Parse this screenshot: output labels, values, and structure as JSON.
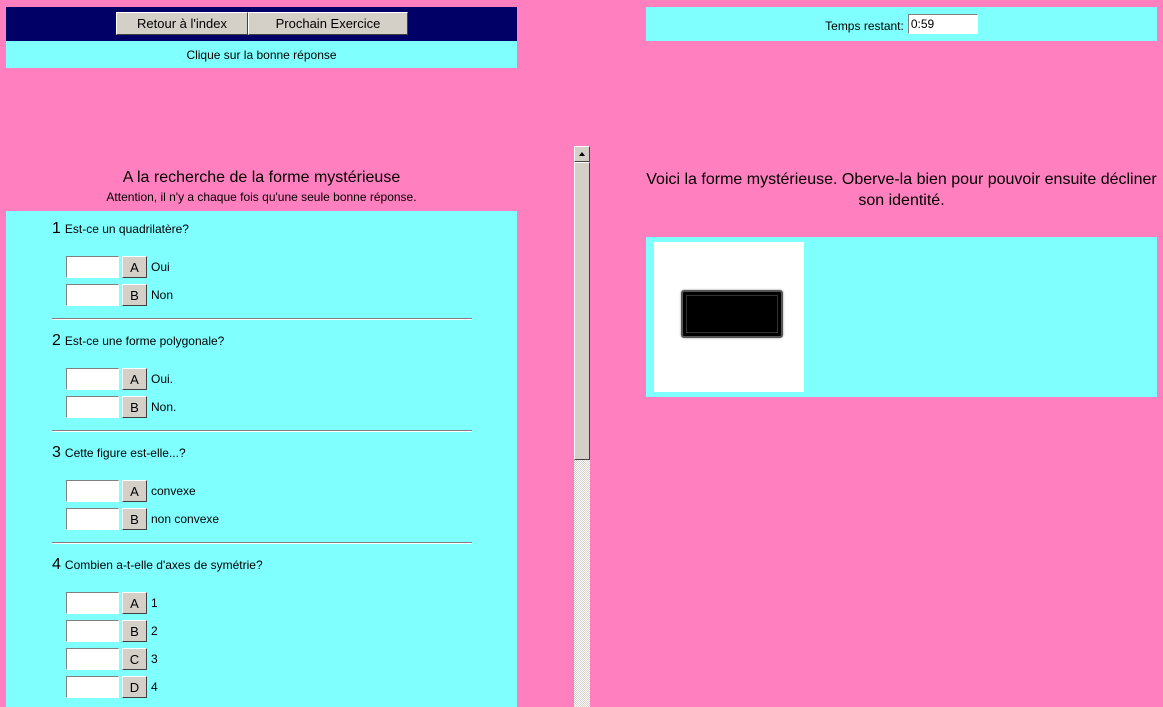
{
  "nav": {
    "back_label": "Retour à l'index",
    "next_label": "Prochain Exercice"
  },
  "instruction": "Clique sur la bonne réponse",
  "timer": {
    "label": "Temps restant:",
    "value": "0:59"
  },
  "quiz": {
    "title": "A la recherche de la forme mystérieuse",
    "subtitle": "Attention, il n'y a chaque fois qu'une seule bonne réponse.",
    "questions": [
      {
        "number": "1",
        "text": "Est-ce un quadrilatère?",
        "options": [
          {
            "letter": "A",
            "text": "Oui"
          },
          {
            "letter": "B",
            "text": "Non"
          }
        ]
      },
      {
        "number": "2",
        "text": "Est-ce une forme polygonale?",
        "options": [
          {
            "letter": "A",
            "text": "Oui."
          },
          {
            "letter": "B",
            "text": "Non."
          }
        ]
      },
      {
        "number": "3",
        "text": "Cette figure est-elle...?",
        "options": [
          {
            "letter": "A",
            "text": "convexe"
          },
          {
            "letter": "B",
            "text": "non convexe"
          }
        ]
      },
      {
        "number": "4",
        "text": "Combien a-t-elle d'axes de symétrie?",
        "options": [
          {
            "letter": "A",
            "text": "1"
          },
          {
            "letter": "B",
            "text": "2"
          },
          {
            "letter": "C",
            "text": "3"
          },
          {
            "letter": "D",
            "text": "4"
          }
        ]
      }
    ]
  },
  "mystery": {
    "text": "Voici la forme mystérieuse. Oberve-la bien pour pouvoir ensuite décliner son identité."
  },
  "colors": {
    "background": "#ff7fbf",
    "panel": "#80ffff",
    "nav_bar": "#000066",
    "button": "#d4d0c8"
  }
}
